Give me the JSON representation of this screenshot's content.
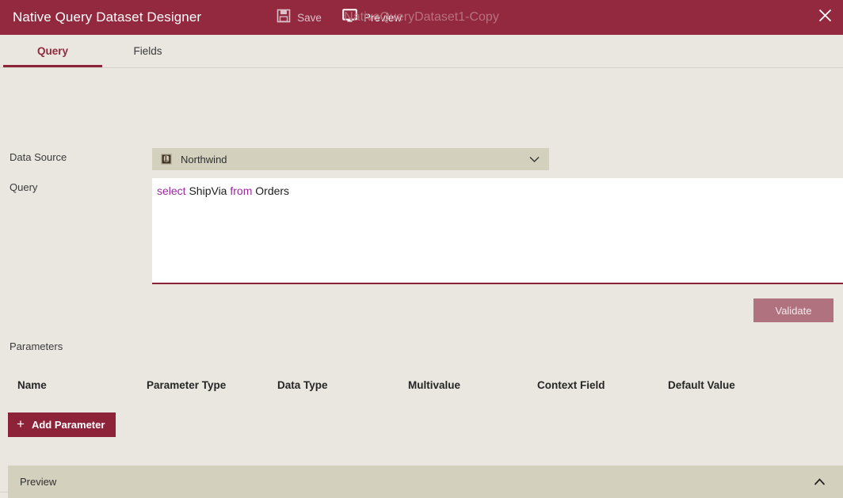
{
  "titlebar": {
    "app_title": "Native Query Dataset Designer",
    "document_name": "NativeQueryDataset1-Copy",
    "save_label": "Save",
    "preview_label": "Preview",
    "save_icon": "floppy-disk-icon",
    "preview_icon": "monitor-icon",
    "close_icon": "close-icon",
    "background_color": "#93293f",
    "document_name_color": "#b9707f"
  },
  "tabs": [
    {
      "label": "Query",
      "active": true
    },
    {
      "label": "Fields",
      "active": false
    }
  ],
  "form": {
    "data_source_label": "Data Source",
    "data_source_value": "Northwind",
    "data_source_icon": "database-icon",
    "data_source_caret_icon": "chevron-down-icon",
    "query_label": "Query",
    "query_tokens": [
      {
        "text": "select",
        "type": "keyword"
      },
      {
        "text": " ",
        "type": "plain"
      },
      {
        "text": "ShipVia",
        "type": "identifier"
      },
      {
        "text": " ",
        "type": "plain"
      },
      {
        "text": "from",
        "type": "keyword"
      },
      {
        "text": " ",
        "type": "plain"
      },
      {
        "text": "Orders",
        "type": "identifier"
      }
    ],
    "query_text": "select ShipVia from Orders",
    "validate_label": "Validate",
    "validate_enabled": false,
    "keyword_color": "#9c28a0",
    "identifier_color": "#1d1d1d"
  },
  "parameters": {
    "section_label": "Parameters",
    "columns": [
      "Name",
      "Parameter Type",
      "Data Type",
      "Multivalue",
      "Context Field",
      "Default Value"
    ],
    "rows": [],
    "add_button_label": "Add Parameter",
    "add_button_icon": "plus-icon",
    "add_button_color": "#8d2339"
  },
  "footer": {
    "preview_label": "Preview",
    "expand_icon": "chevron-up-icon",
    "background_color": "#d3d1be"
  }
}
